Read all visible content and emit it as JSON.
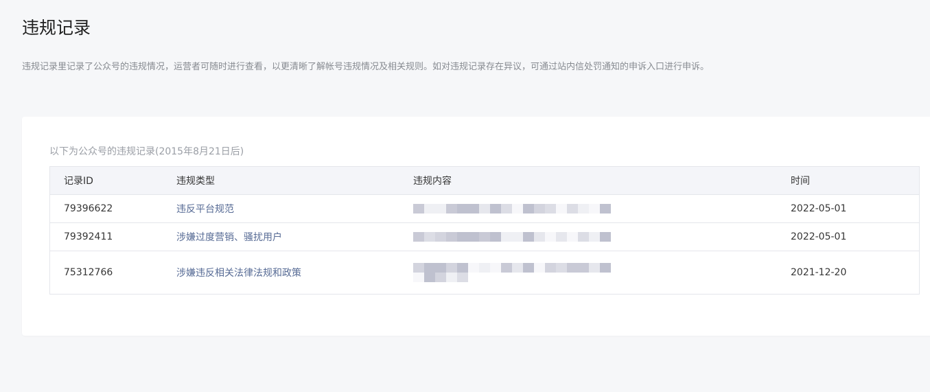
{
  "page": {
    "title": "违规记录",
    "description": "违规记录里记录了公众号的违规情况，运营者可随时进行查看，以更清晰了解帐号违规情况及相关规则。如对违规记录存在异议，可通过站内信处罚通知的申诉入口进行申诉。"
  },
  "card": {
    "caption": "以下为公众号的违规记录(2015年8月21日后)"
  },
  "table": {
    "headers": {
      "id": "记录ID",
      "type": "违规类型",
      "content": "违规内容",
      "time": "时间"
    },
    "rows": [
      {
        "id": "79396622",
        "type": "违反平台规范",
        "time": "2022-05-01"
      },
      {
        "id": "79392411",
        "type": "涉嫌过度营销、骚扰用户",
        "time": "2022-05-01"
      },
      {
        "id": "75312766",
        "type": "涉嫌违反相关法律法规和政策",
        "time": "2021-12-20"
      }
    ]
  },
  "colors": {
    "page_bg": "#f6f7f9",
    "card_bg": "#ffffff",
    "link": "#576b95",
    "header_bg": "#f4f5f9",
    "border": "#e4e6eb"
  }
}
